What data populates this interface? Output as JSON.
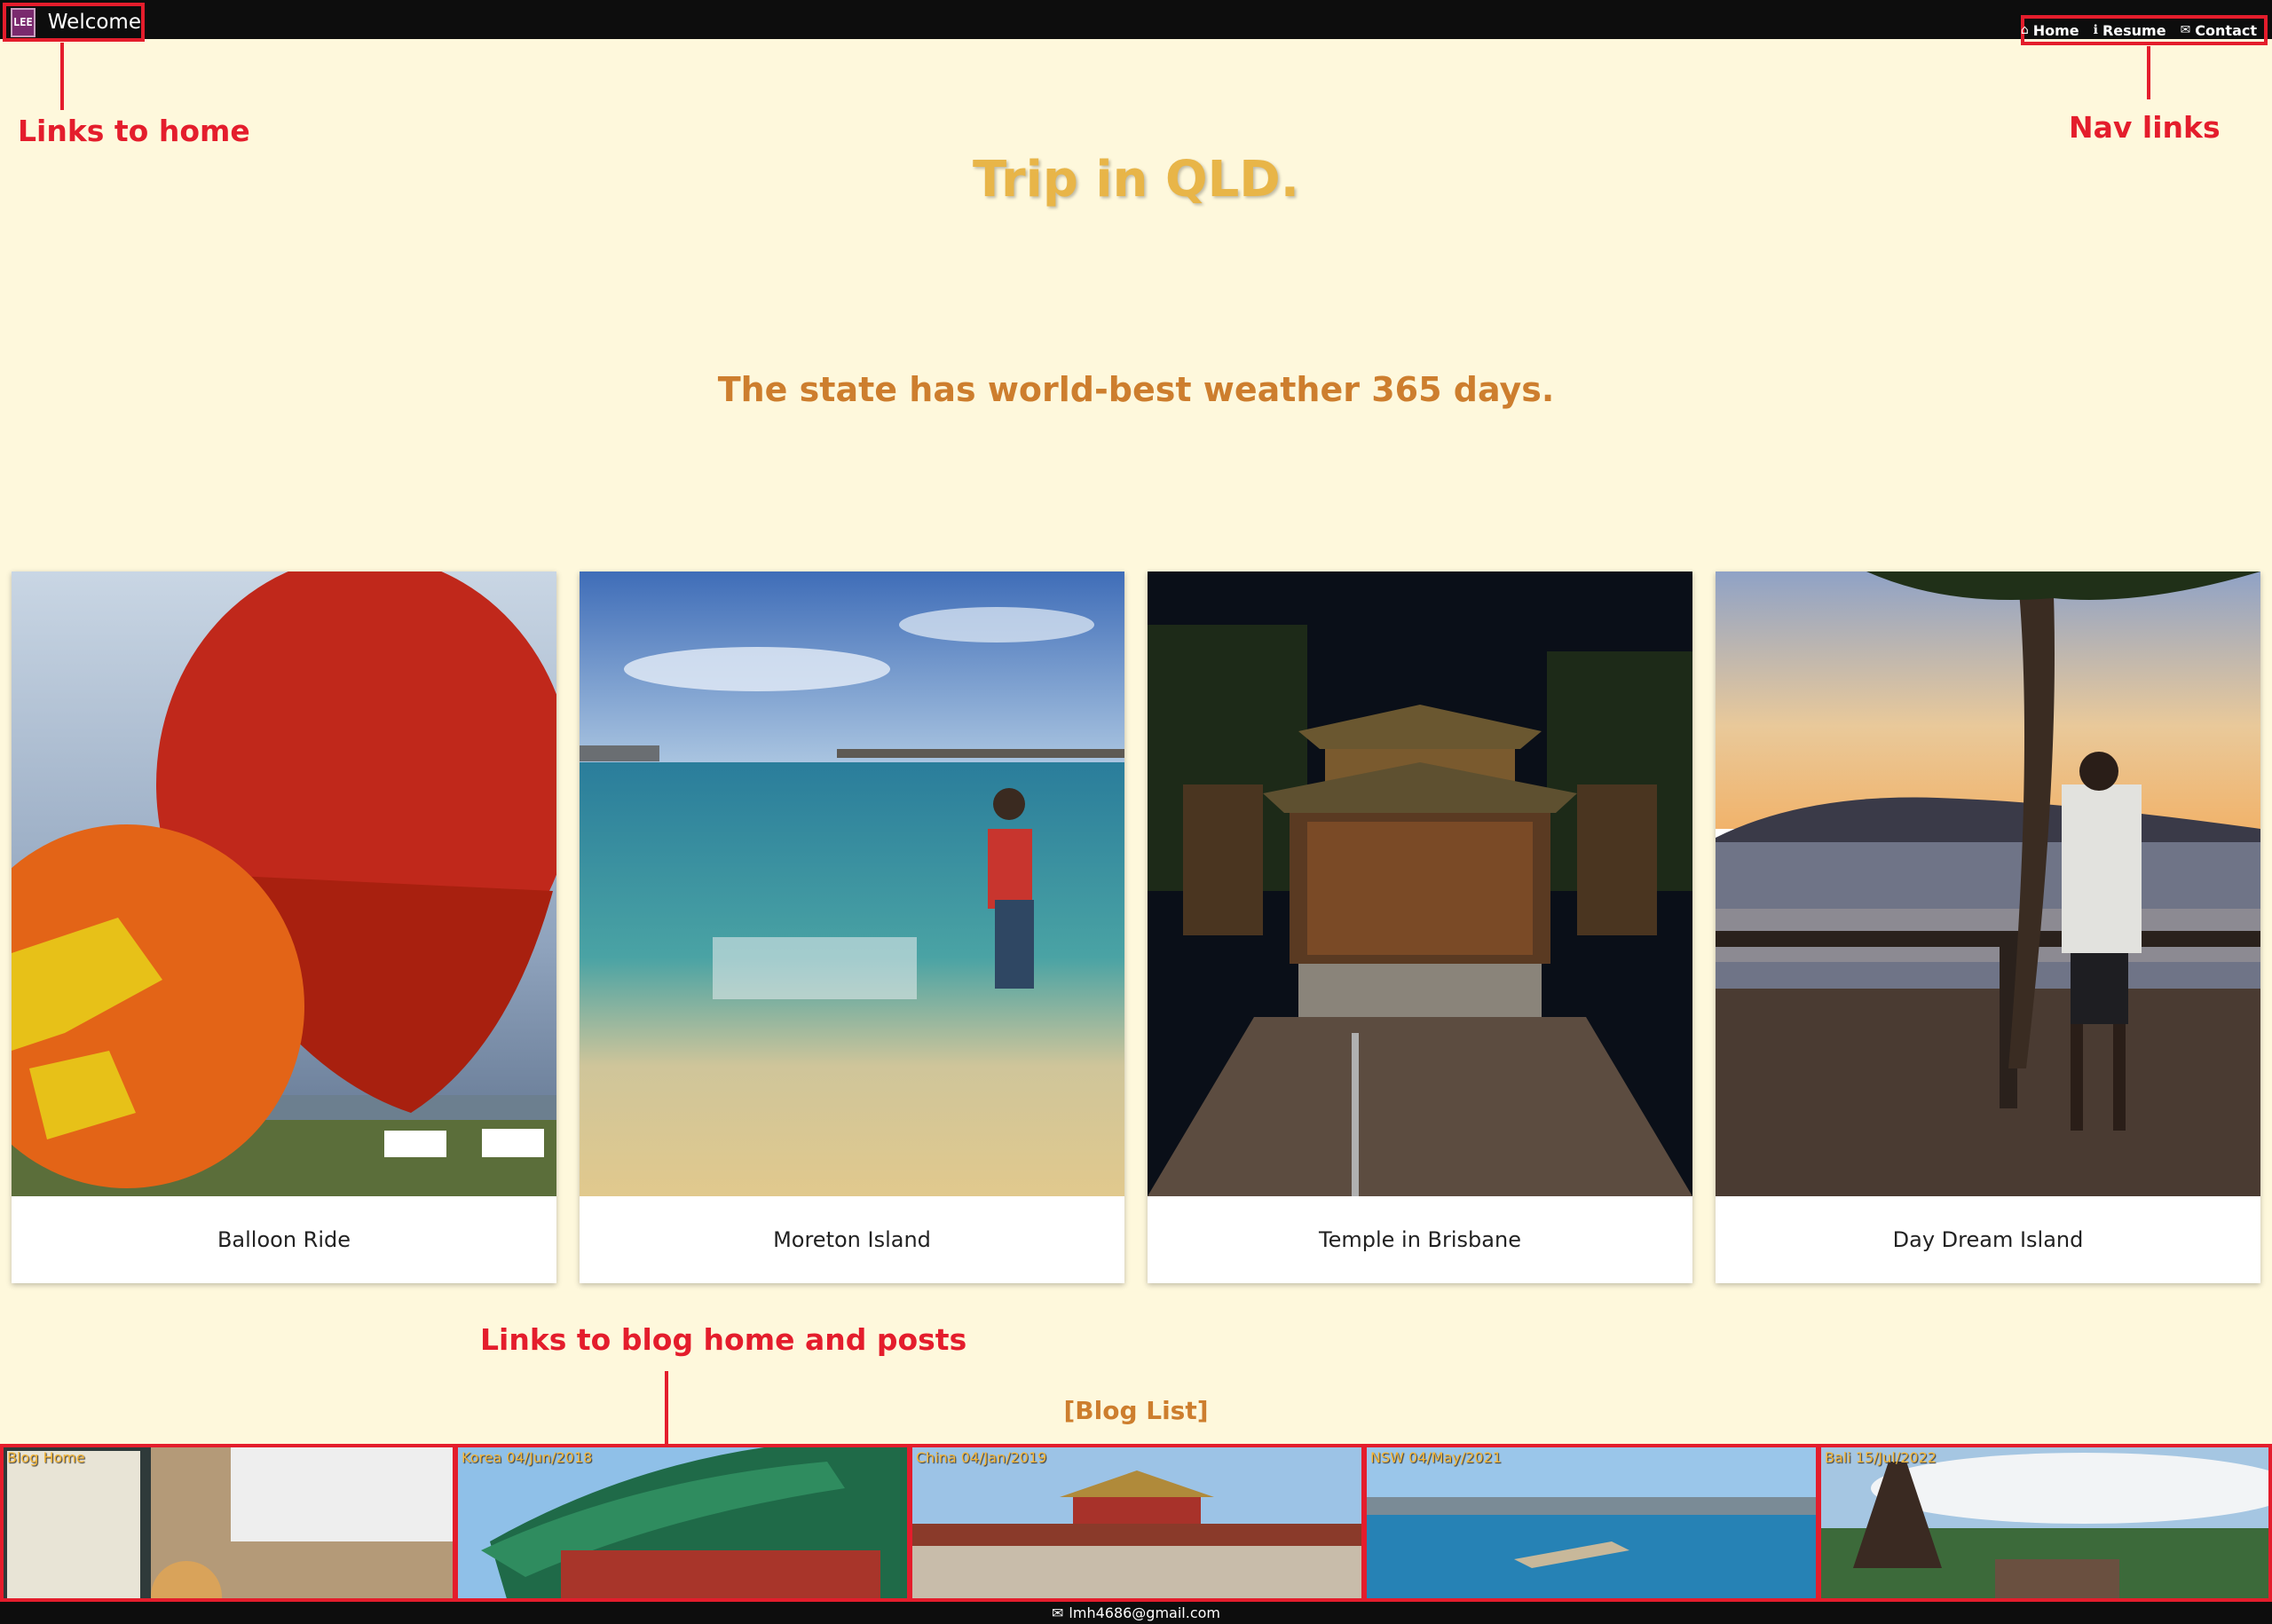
{
  "header": {
    "logo_text": "LEE",
    "brand_title": "Welcome",
    "nav": [
      {
        "icon": "home-icon",
        "glyph": "⌂",
        "label": "Home"
      },
      {
        "icon": "info-icon",
        "glyph": "ℹ",
        "label": "Resume"
      },
      {
        "icon": "mail-icon",
        "glyph": "✉",
        "label": "Contact"
      }
    ]
  },
  "annotations": {
    "links_home": "Links to home",
    "nav_links": "Nav links",
    "blog_links": "Links to blog home and posts"
  },
  "main": {
    "title": "Trip in QLD.",
    "subtitle": "The state has world-best weather 365 days.",
    "cards": [
      {
        "caption": "Balloon Ride",
        "image": "hot-air-balloons"
      },
      {
        "caption": "Moreton Island",
        "image": "beach-kayak"
      },
      {
        "caption": "Temple in Brisbane",
        "image": "nepalese-temple-night"
      },
      {
        "caption": "Day Dream Island",
        "image": "sunset-island-view"
      }
    ]
  },
  "blog": {
    "heading": "[Blog List]",
    "tiles": [
      {
        "label": "Blog Home"
      },
      {
        "label": "Korea 04/Jun/2018"
      },
      {
        "label": "China 04/Jan/2019"
      },
      {
        "label": "NSW 04/May/2021"
      },
      {
        "label": "Bali 15/Jul/2022"
      }
    ]
  },
  "footer": {
    "icon": "mail-icon",
    "glyph": "✉",
    "email": "lmh4686@gmail.com"
  },
  "colors": {
    "background": "#fef8dc",
    "topbar": "#0d0d0d",
    "title": "#e8b548",
    "subtitle": "#cd7e2e",
    "annotation": "#e41d2c"
  }
}
